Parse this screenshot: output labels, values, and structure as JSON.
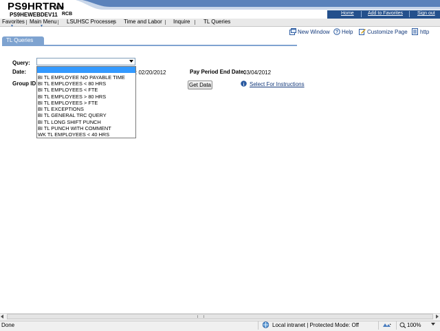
{
  "header": {
    "title": "PS9HRTRN",
    "version": "8.50",
    "server": "PS9HEWEBDEV11",
    "user": "RCB",
    "links": [
      "Home",
      "Add to Favorites",
      "Sign out"
    ]
  },
  "menu": {
    "items": [
      "Favorites",
      "Main Menu",
      "LSUHSC Processes",
      "Time and Labor",
      "Inquire",
      "TL Queries"
    ]
  },
  "toolbar": {
    "new_window": "New Window",
    "help": "Help",
    "customize": "Customize Page",
    "http": "http"
  },
  "tab": {
    "label": "TL Queries"
  },
  "form": {
    "query_label": "Query:",
    "date_label": "Date:",
    "date_value_fragment": ": 02/20/2012",
    "group_id_label": "Group ID:",
    "pay_period_end_label": "Pay Period End Date:",
    "pay_period_end_value": "03/04/2012",
    "get_data_button": "Get Data",
    "instructions_link": "Select For Instructions",
    "query_value": ""
  },
  "dropdown": {
    "options": [
      "BI TL EMPLOYEE NO PAYABLE TIME",
      "BI TL EMPLOYEES < 80 HRS",
      "BI TL EMPLOYEES < FTE",
      "BI TL EMPLOYEES > 80 HRS",
      "BI TL EMPLOYEES > FTE",
      "BI TL EXCEPTIONS",
      "BI TL GENERAL TRC QUERY",
      "BI TL LONG SHIFT PUNCH",
      "BI TL PUNCH WITH COMMENT",
      "WK TL EMPLOYEES < 40 HRS"
    ]
  },
  "statusbar": {
    "status": "Done",
    "zone": "Local intranet | Protected Mode: Off",
    "zoom": "100%"
  },
  "colors": {
    "header_blue": "#24508c",
    "tab_blue": "#7ea3d0",
    "link_blue": "#12387a",
    "selection_blue": "#3399ff"
  }
}
